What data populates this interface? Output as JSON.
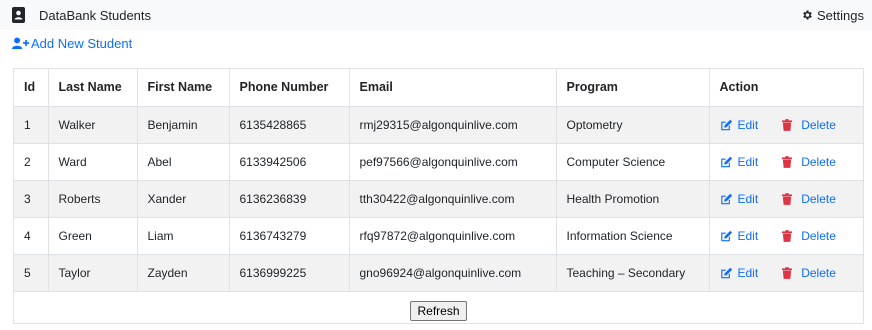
{
  "header": {
    "title": "DataBank Students",
    "settings_label": "Settings",
    "brand_icon": "address-book-icon",
    "settings_icon": "gear-icon"
  },
  "add_student": {
    "label": "Add New Student",
    "icon": "user-plus-icon"
  },
  "table": {
    "columns": [
      "Id",
      "Last Name",
      "First Name",
      "Phone Number",
      "Email",
      "Program",
      "Action"
    ],
    "rows": [
      {
        "id": "1",
        "last": "Walker",
        "first": "Benjamin",
        "phone": "6135428865",
        "email": "rmj29315@algonquinlive.com",
        "program": "Optometry"
      },
      {
        "id": "2",
        "last": "Ward",
        "first": "Abel",
        "phone": "6133942506",
        "email": "pef97566@algonquinlive.com",
        "program": "Computer Science"
      },
      {
        "id": "3",
        "last": "Roberts",
        "first": "Xander",
        "phone": "6136236839",
        "email": "tth30422@algonquinlive.com",
        "program": "Health Promotion"
      },
      {
        "id": "4",
        "last": "Green",
        "first": "Liam",
        "phone": "6136743279",
        "email": "rfq97872@algonquinlive.com",
        "program": "Information Science"
      },
      {
        "id": "5",
        "last": "Taylor",
        "first": "Zayden",
        "phone": "6136999225",
        "email": "gno96924@algonquinlive.com",
        "program": "Teaching – Secondary"
      }
    ],
    "edit_label": "Edit",
    "delete_label": "Delete",
    "edit_icon": "edit-icon",
    "delete_icon": "trash-icon"
  },
  "refresh_label": "Refresh",
  "colors": {
    "link": "#0d6efd",
    "delete_icon": "#dc3545",
    "stripe": "#f2f2f2",
    "topbar": "#f8f9fa"
  }
}
